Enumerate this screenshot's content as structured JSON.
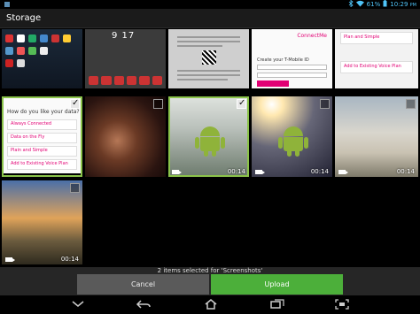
{
  "status_bar": {
    "left_icons": [
      "usb-icon"
    ],
    "battery": "61%",
    "time": "10:29",
    "time_suffix": "PM"
  },
  "action_bar": {
    "title": "Storage"
  },
  "tiles": [
    {
      "kind": "screenshot",
      "selected": false
    },
    {
      "kind": "screenshot",
      "selected": false
    },
    {
      "kind": "screenshot",
      "selected": false
    },
    {
      "kind": "screenshot",
      "selected": false
    },
    {
      "kind": "screenshot",
      "selected": false
    },
    {
      "kind": "screenshot",
      "selected": true
    },
    {
      "kind": "photo",
      "selected": false
    },
    {
      "kind": "video",
      "selected": true,
      "duration": "00:14"
    },
    {
      "kind": "video",
      "selected": false,
      "duration": "00:14"
    },
    {
      "kind": "video",
      "selected": false,
      "duration": "00:14"
    },
    {
      "kind": "video",
      "selected": false,
      "duration": "00:14"
    }
  ],
  "thumb_text": {
    "lock_clock": "9 17",
    "form_brand": "ConnectMe",
    "form_heading": "Create your T-Mobile ID",
    "plan_card_1": "Plan and Simple",
    "plan_card_2": "Add to Existing Voice Plan",
    "data_question": "How do you like your data?",
    "data_opt_1": "Always Connected",
    "data_opt_2": "Data on the Fly",
    "data_opt_3": "Plain and Simple",
    "data_opt_4": "Add to Existing Voice Plan"
  },
  "selection_bar": {
    "message": "2 items selected for 'Screenshots'",
    "cancel_label": "Cancel",
    "upload_label": "Upload"
  },
  "colors": {
    "accent_green": "#4caf3a",
    "check_blue": "#4fc3f7",
    "brand_magenta": "#e20074"
  },
  "nav_bar": [
    "hide-keyboard-icon",
    "back-icon",
    "home-icon",
    "recent-apps-icon",
    "screenshot-icon"
  ]
}
